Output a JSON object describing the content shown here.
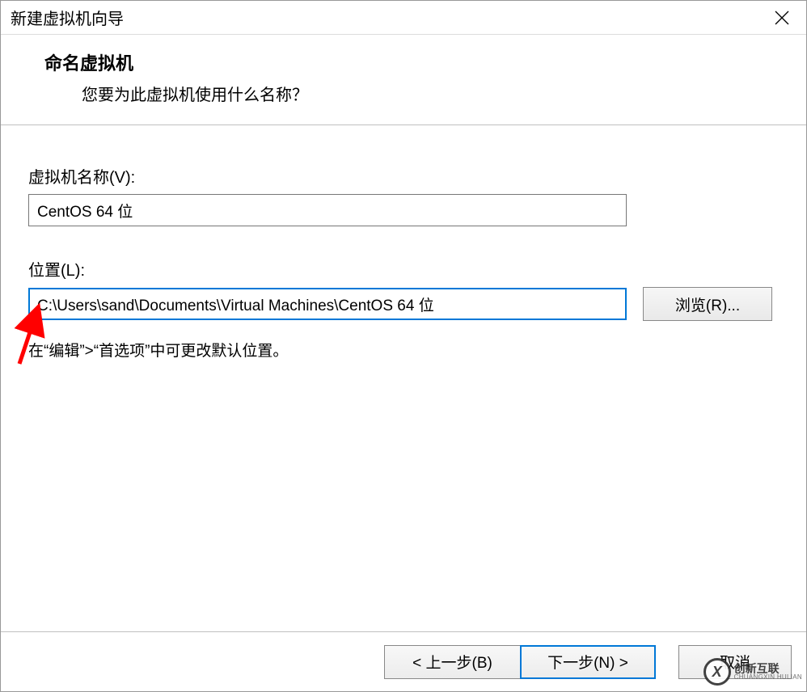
{
  "titlebar": {
    "title": "新建虚拟机向导"
  },
  "header": {
    "title": "命名虚拟机",
    "subtitle": "您要为此虚拟机使用什么名称？"
  },
  "form": {
    "name_label": "虚拟机名称(V):",
    "name_value": "CentOS 64 位",
    "location_label": "位置(L):",
    "location_value": "C:\\Users\\sand\\Documents\\Virtual Machines\\CentOS 64 位",
    "browse_label": "浏览(R)...",
    "hint": "在“编辑”>“首选项”中可更改默认位置。"
  },
  "footer": {
    "back": "< 上一步(B)",
    "next": "下一步(N) >",
    "cancel": "取消"
  },
  "watermark": {
    "badge": "X",
    "cn": "创新互联",
    "en": "CHUANGXIN HULIAN"
  }
}
